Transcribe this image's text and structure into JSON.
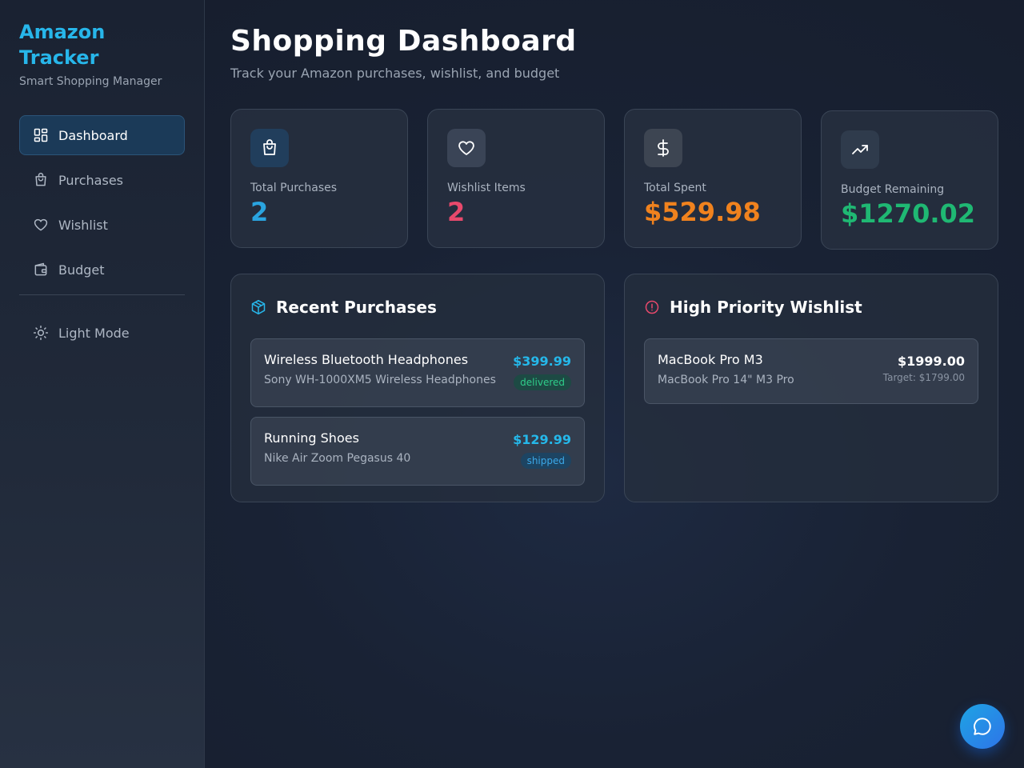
{
  "sidebar": {
    "brand_title": "Amazon Tracker",
    "brand_subtitle": "Smart Shopping Manager",
    "items": [
      {
        "label": "Dashboard",
        "icon": "dashboard-icon",
        "active": true
      },
      {
        "label": "Purchases",
        "icon": "shopping-bag-icon"
      },
      {
        "label": "Wishlist",
        "icon": "heart-icon"
      },
      {
        "label": "Budget",
        "icon": "wallet-icon"
      }
    ],
    "theme_toggle": {
      "label": "Light Mode",
      "icon": "sun-icon"
    }
  },
  "header": {
    "title": "Shopping Dashboard",
    "subtitle": "Track your Amazon purchases, wishlist, and budget"
  },
  "stats": [
    {
      "label": "Total Purchases",
      "value": "2",
      "icon": "shopping-bag-icon",
      "color": "#2aa4e0",
      "icon_bg": "#213e5c",
      "icon_color": "#ffffff"
    },
    {
      "label": "Wishlist Items",
      "value": "2",
      "icon": "heart-icon",
      "color": "#e8496c",
      "icon_bg": "#3a4456",
      "icon_color": "#ffffff"
    },
    {
      "label": "Total Spent",
      "value": "$529.98",
      "icon": "dollar-icon",
      "color": "#f0821e",
      "icon_bg": "#3d4552",
      "icon_color": "#ffffff"
    },
    {
      "label": "Budget Remaining",
      "value": "$1270.02",
      "icon": "trending-up-icon",
      "color": "#1fb873",
      "icon_bg": "#2f3b4c",
      "icon_color": "#ffffff"
    }
  ],
  "recent_purchases": {
    "title": "Recent Purchases",
    "icon": "package-icon",
    "items": [
      {
        "name": "Wireless Bluetooth Headphones",
        "description": "Sony WH-1000XM5 Wireless Headphones",
        "price": "$399.99",
        "status": "delivered"
      },
      {
        "name": "Running Shoes",
        "description": "Nike Air Zoom Pegasus 40",
        "price": "$129.99",
        "status": "shipped"
      }
    ]
  },
  "wishlist": {
    "title": "High Priority Wishlist",
    "icon": "alert-circle-icon",
    "items": [
      {
        "name": "MacBook Pro M3",
        "description": "MacBook Pro 14\" M3 Pro",
        "price": "$1999.00",
        "target": "Target: $1799.00"
      }
    ]
  },
  "chat_button": {
    "icon": "chat-bubble-icon"
  },
  "colors": {
    "accent": "#27b6ea",
    "danger": "#e8496c",
    "warning": "#f0821e",
    "success": "#1fb873"
  }
}
